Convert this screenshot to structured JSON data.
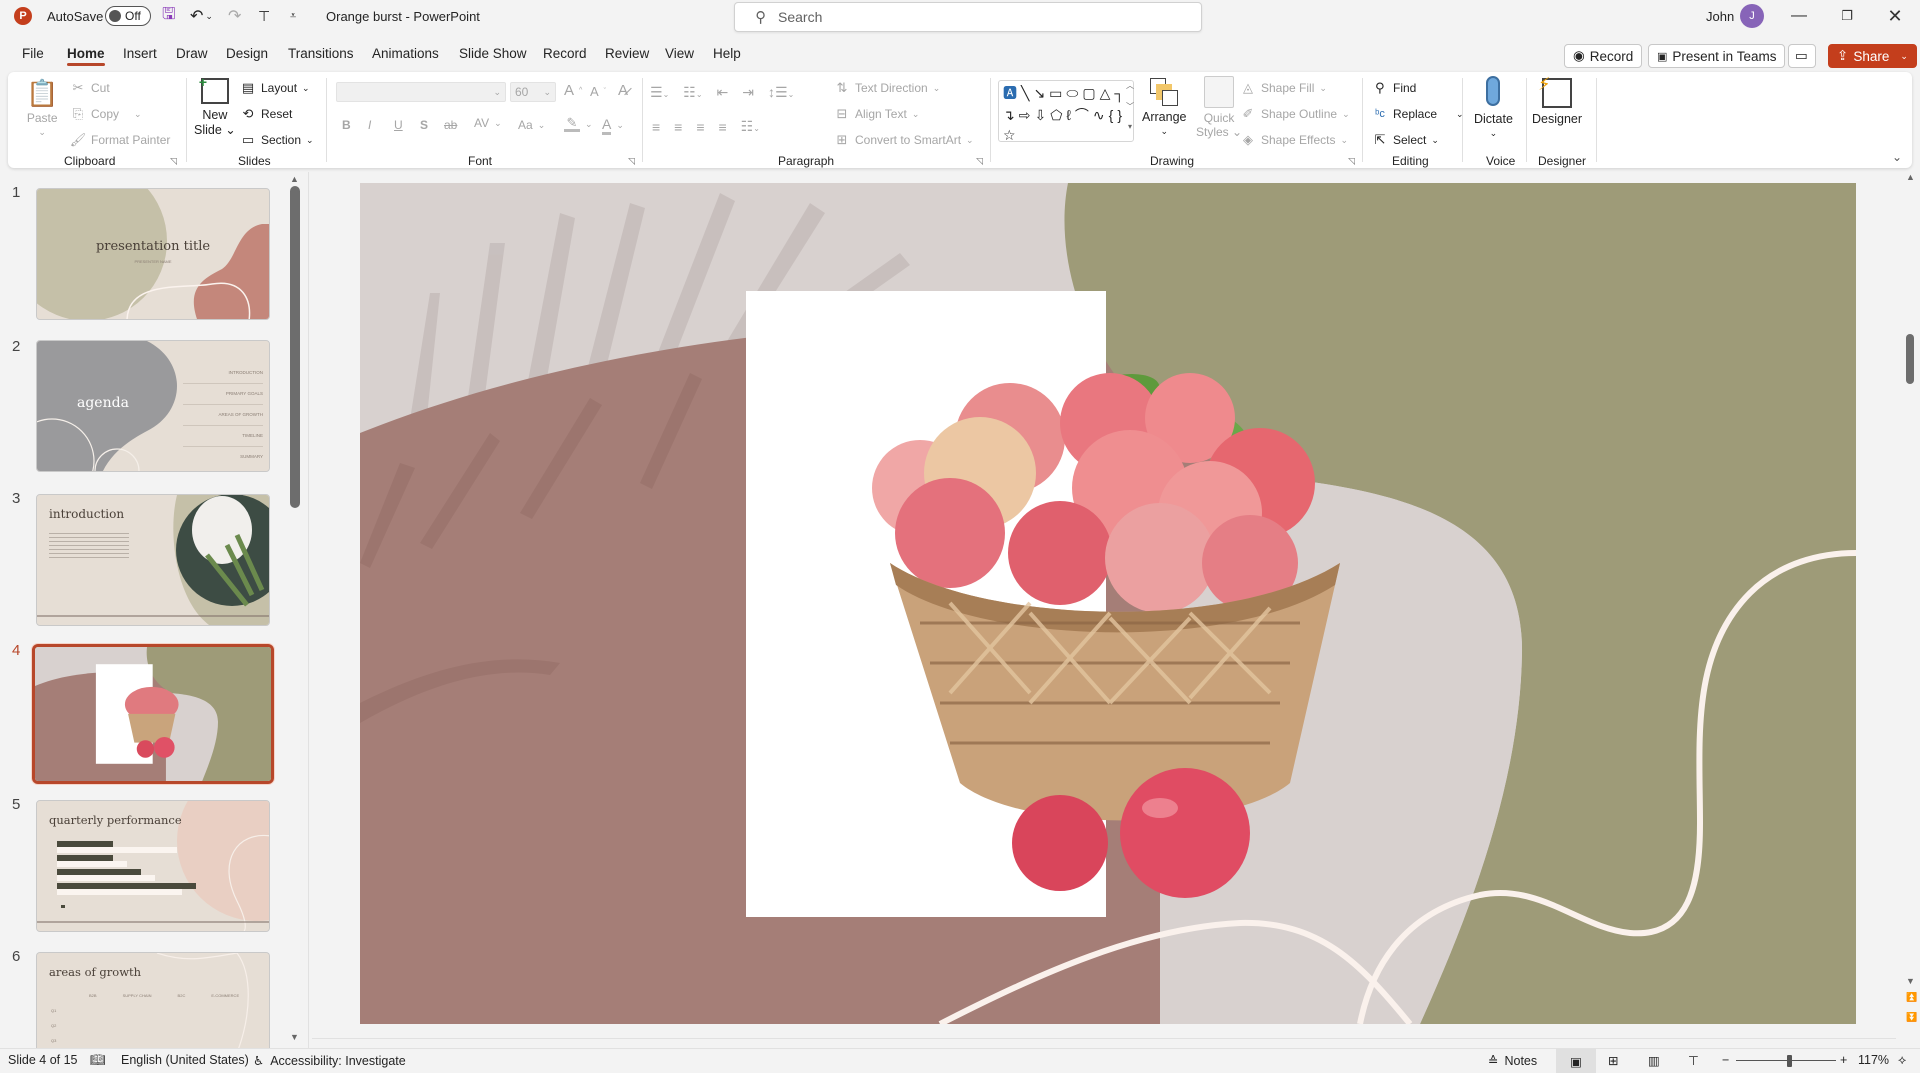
{
  "titlebar": {
    "autosave_label": "AutoSave",
    "autosave_state": "Off",
    "document_title": "Orange burst  -  PowerPoint",
    "search_placeholder": "Search",
    "user_name": "John",
    "user_initial": "J"
  },
  "tabs": [
    {
      "label": "File"
    },
    {
      "label": "Home",
      "active": true
    },
    {
      "label": "Insert"
    },
    {
      "label": "Draw"
    },
    {
      "label": "Design"
    },
    {
      "label": "Transitions"
    },
    {
      "label": "Animations"
    },
    {
      "label": "Slide Show"
    },
    {
      "label": "Record"
    },
    {
      "label": "Review"
    },
    {
      "label": "View"
    },
    {
      "label": "Help"
    }
  ],
  "tab_actions": {
    "record": "Record",
    "present_teams": "Present in Teams",
    "share": "Share"
  },
  "ribbon": {
    "clipboard": {
      "label": "Clipboard",
      "paste": "Paste",
      "cut": "Cut",
      "copy": "Copy",
      "format_painter": "Format Painter"
    },
    "slides": {
      "label": "Slides",
      "new_slide_1": "New",
      "new_slide_2": "Slide",
      "layout": "Layout",
      "reset": "Reset",
      "section": "Section"
    },
    "font": {
      "label": "Font",
      "font_name": "",
      "font_size": "60",
      "bold": "B",
      "italic": "I",
      "underline": "U",
      "shadow": "S",
      "strike": "ab",
      "spacing": "AV",
      "case": "Aa",
      "color": "A"
    },
    "paragraph": {
      "label": "Paragraph",
      "text_direction": "Text Direction",
      "align_text": "Align Text",
      "convert_smartart": "Convert to SmartArt"
    },
    "drawing": {
      "label": "Drawing",
      "arrange": "Arrange",
      "quick_styles_1": "Quick",
      "quick_styles_2": "Styles",
      "shape_fill": "Shape Fill",
      "shape_outline": "Shape Outline",
      "shape_effects": "Shape Effects"
    },
    "editing": {
      "label": "Editing",
      "find": "Find",
      "replace": "Replace",
      "select": "Select"
    },
    "voice": {
      "label": "Voice",
      "dictate": "Dictate"
    },
    "designer": {
      "label": "Designer",
      "designer": "Designer"
    }
  },
  "thumbnails": [
    {
      "num": "1",
      "title": "presentation title",
      "subtitle": "PRESENTER NAME"
    },
    {
      "num": "2",
      "title": "agenda",
      "items": [
        "INTRODUCTION",
        "PRIMARY GOALS",
        "AREAS OF GROWTH",
        "TIMELINE",
        "SUMMARY"
      ]
    },
    {
      "num": "3",
      "title": "introduction"
    },
    {
      "num": "4",
      "title": "",
      "selected": true
    },
    {
      "num": "5",
      "title": "quarterly performance"
    },
    {
      "num": "6",
      "title": "areas of growth",
      "columns": [
        "B2B",
        "SUPPLY CHAIN",
        "B2C",
        "E-COMMERCE"
      ],
      "rows": [
        "Q1",
        "Q2",
        "Q3"
      ]
    }
  ],
  "slide": {
    "colors": {
      "background": "#d8d1cf",
      "mauve": "#a57e77",
      "olive": "#9e9b78",
      "line": "#faf1ec",
      "photo_bg": "#ffffff"
    },
    "image_alt": "Basket of red apples"
  },
  "statusbar": {
    "slide_info": "Slide 4 of 15",
    "language": "English (United States)",
    "accessibility": "Accessibility: Investigate",
    "notes": "Notes",
    "zoom_percent": "117%",
    "zoom_value": 117
  }
}
